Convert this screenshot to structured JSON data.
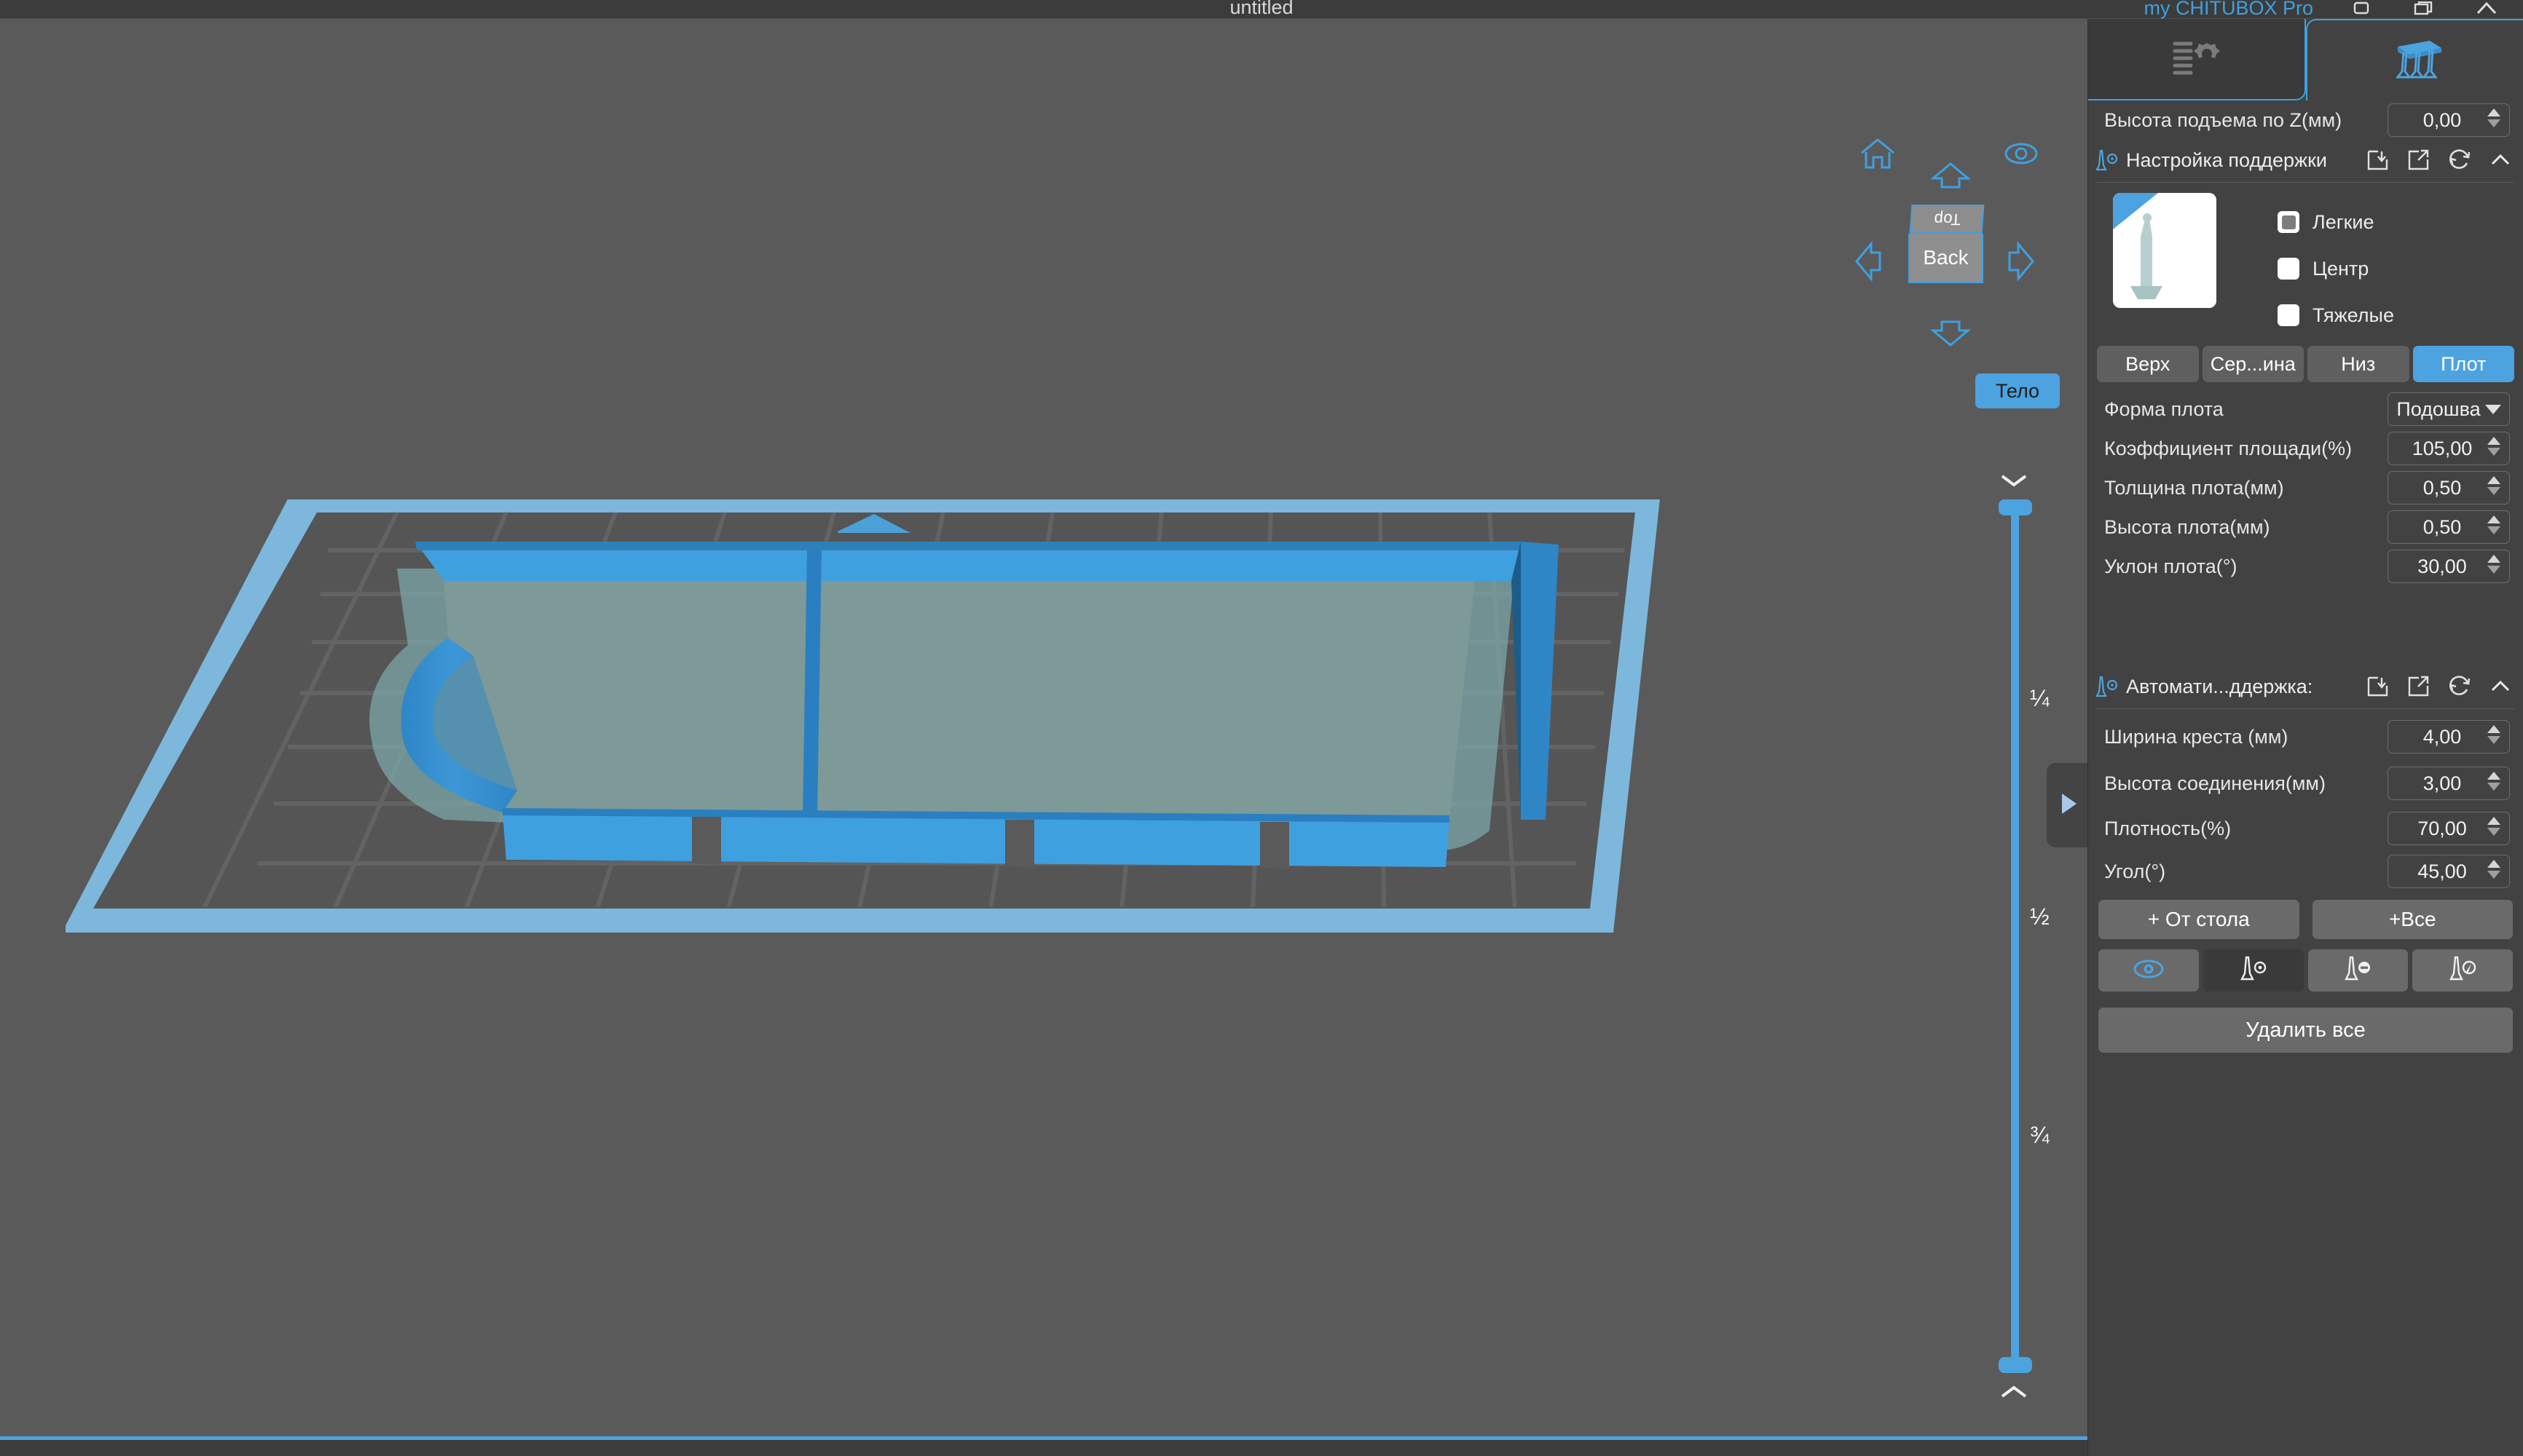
{
  "titlebar": {
    "title": "untitled",
    "app_name": "my CHITUBOX Pro",
    "minimize_icon": "minimize-icon",
    "maximize_icon": "maximize-icon",
    "close_icon": "close-icon"
  },
  "viewport": {
    "nav": {
      "home_icon": "home-icon",
      "eye_icon": "eye-icon",
      "arrow_up_icon": "arrow-up-icon",
      "arrow_down_icon": "arrow-down-icon",
      "arrow_left_icon": "arrow-left-icon",
      "arrow_right_icon": "arrow-right-icon"
    },
    "navcube": {
      "top_face": "Top",
      "front_face": "Back"
    },
    "body_button": "Тело",
    "slider": {
      "tick_quarter": "¼",
      "tick_half": "½",
      "tick_three_quarter": "¾",
      "chevron_up_icon": "chevron-up-icon",
      "chevron_down_icon": "chevron-down-icon"
    },
    "panel_toggle_icon": "triangle-right-icon",
    "accent_color": "#4da3e0",
    "plate_color": "#4da3e0",
    "model_color": "#3fa0e0"
  },
  "panel": {
    "tabs": [
      {
        "name": "settings-tab",
        "icon": "sliders-gear-icon",
        "active": false
      },
      {
        "name": "support-tab",
        "icon": "supports-icon",
        "active": true
      }
    ],
    "z_lift": {
      "label": "Высота подъема по Z(мм)",
      "value": "0,00"
    },
    "support_settings": {
      "icon": "support-pillar-icon",
      "title": "Настройка поддержки",
      "header_icons": [
        "import-icon",
        "export-icon",
        "reset-icon",
        "collapse-icon"
      ],
      "preview_icon": "support-preview-image",
      "checkboxes": [
        {
          "label": "Легкие",
          "checked": true
        },
        {
          "label": "Центр",
          "checked": false
        },
        {
          "label": "Тяжелые",
          "checked": false
        }
      ],
      "segments": [
        {
          "label": "Верх",
          "active": false
        },
        {
          "label": "Сер...ина",
          "active": false
        },
        {
          "label": "Низ",
          "active": false
        },
        {
          "label": "Плот",
          "active": true
        }
      ],
      "fields": [
        {
          "label": "Форма плота",
          "value": "Подошва",
          "type": "dropdown"
        },
        {
          "label": "Коэффициент площади(%)",
          "value": "105,00",
          "type": "spin"
        },
        {
          "label": "Толщина плота(мм)",
          "value": "0,50",
          "type": "spin"
        },
        {
          "label": "Высота плота(мм)",
          "value": "0,50",
          "type": "spin"
        },
        {
          "label": "Уклон плота(°)",
          "value": "30,00",
          "type": "spin"
        }
      ]
    },
    "auto_support": {
      "icon": "support-pillar-icon",
      "title": "Автомати...ддержка:",
      "header_icons": [
        "import-icon",
        "export-icon",
        "reset-icon",
        "collapse-icon"
      ],
      "fields": [
        {
          "label": "Ширина креста (мм)",
          "value": "4,00"
        },
        {
          "label": "Высота соединения(мм)",
          "value": "3,00"
        },
        {
          "label": "Плотность(%)",
          "value": "70,00"
        },
        {
          "label": "Угол(°)",
          "value": "45,00"
        }
      ],
      "actions": [
        {
          "label": "+ От стола"
        },
        {
          "label": "+Все"
        }
      ],
      "icon_buttons": [
        {
          "name": "show-supports-icon",
          "selected": false
        },
        {
          "name": "add-support-icon",
          "selected": true
        },
        {
          "name": "remove-support-icon",
          "selected": false
        },
        {
          "name": "edit-support-icon",
          "selected": false
        }
      ],
      "delete_all": "Удалить все"
    }
  }
}
